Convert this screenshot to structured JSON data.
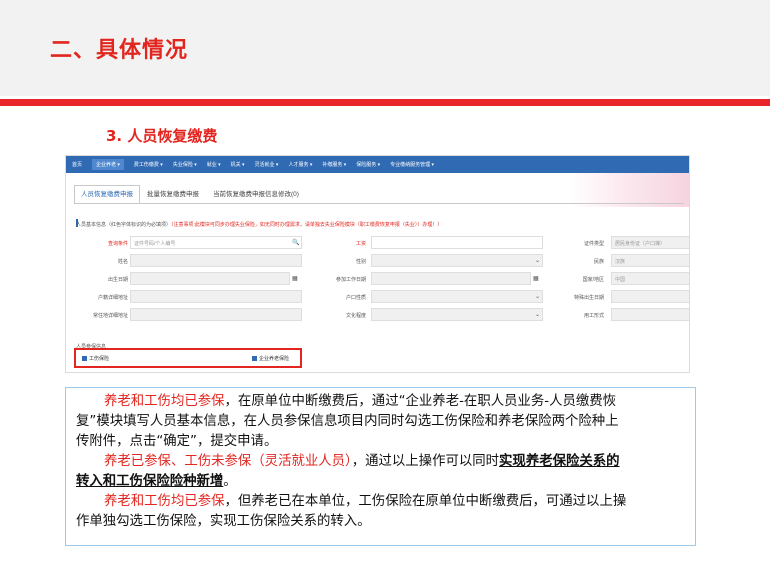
{
  "slide": {
    "title": "二、具体情况",
    "section_title": "3. 人员恢复缴费"
  },
  "app": {
    "nav": [
      "首页",
      "企业养老 ▾",
      "费工伤缴费 ▾",
      "失业保险 ▾",
      "就业 ▾",
      "机关 ▾",
      "灵活就业 ▾",
      "人才服务 ▾",
      "补缴服务 ▾",
      "保险服务 ▾",
      "专业缴纳服务管理 ▾"
    ],
    "nav_active_index": 1,
    "tabs": [
      "人员恢复缴费申报",
      "批量恢复缴费申报",
      "当前恢复缴费申报信息修改(0)"
    ],
    "notice_label": "人员基本信息（红色字体标识的为必填项）",
    "notice_warn": "（注意事项:此模块可同步办理失业保险，如无同时办理需求，请单独去失业保险模块（职工缴费恢复申报（失业））办理！）",
    "fields": {
      "id_type_label": "证件类型",
      "id_no_label": "查询条件",
      "id_no_placeholder": "证件号码/个人编号",
      "salary_label": "工资",
      "id_type_value": "居民身份证（户口簿）",
      "name_label": "姓名",
      "gender_label": "性别",
      "nation_label": "民族",
      "nation_value": "汉族",
      "birth_label": "出生日期",
      "work_date_label": "参加工作日期",
      "country_label": "国家/地区",
      "country_value": "中国",
      "household_addr_label": "户籍详细地址",
      "household_type_label": "户口性质",
      "special_birth_label": "特殊出生日期",
      "residence_label": "常住地详细地址",
      "education_label": "文化程度",
      "employment_label": "用工形式"
    },
    "insurance_section_label": "人员参保信息",
    "checkboxes": [
      "工伤保险",
      "企业养老保险"
    ]
  },
  "text": {
    "p1": {
      "red": "养老和工伤均已参保",
      "line1_rest": "，在原单位中断缴费后，通过“企业养老-在职人员业务-人员缴费恢",
      "line2": "复”模块填写人员基本信息，在人员参保信息项目内同时勾选工伤保险和养老保险两个险种上",
      "line3": "传附件，点击“确定”，提交申请。"
    },
    "p2": {
      "red": "养老已参保、工伤未参保（灵活就业人员）",
      "line1_rest": "，通过以上操作可以同时",
      "bold1": "实现养老保险关系的",
      "bold2": "转入和工伤保险险种新增",
      "end": "。"
    },
    "p3": {
      "red": "养老和工伤均已参保",
      "line1_rest": "，但养老已在本单位，工伤保险在原单位中断缴费后，可通过以上操",
      "line2": "作单独勾选工伤保险，实现工伤保险关系的转入。"
    }
  },
  "colors": {
    "accent_red": "#e3251f",
    "nav_blue": "#2f6ab3",
    "box_border": "#9ec9e8"
  }
}
